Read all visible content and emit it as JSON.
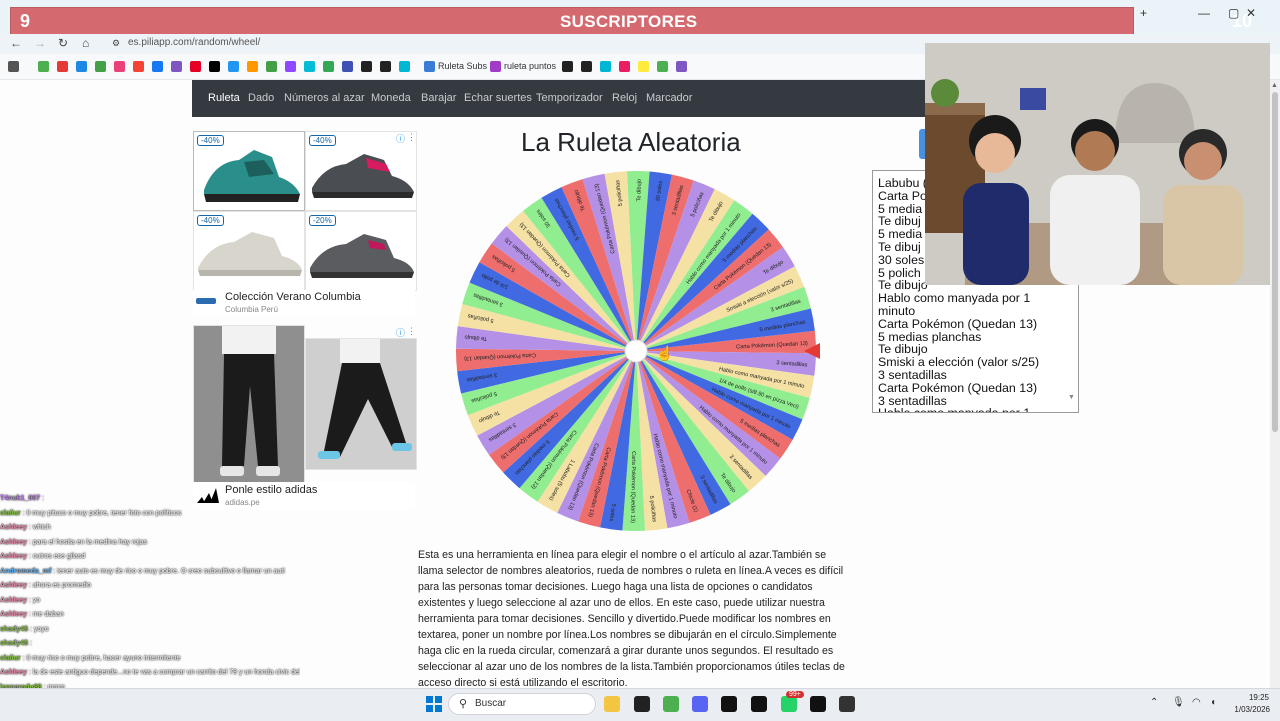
{
  "overlay": {
    "left_count": "9",
    "title": "SUSCRIPTORES",
    "right_count": "10",
    "window_controls": [
      "+",
      "—",
      "▢",
      "✕"
    ]
  },
  "browser": {
    "url": "es.piliapp.com/random/wheel/",
    "bookmarks": [
      {
        "label": "Ruleta Subs",
        "color": "#3a7bd5"
      },
      {
        "label": "ruleta puntos",
        "color": "#a03cc8"
      }
    ],
    "bookmark_icon_colors": [
      "#4caf50",
      "#e53935",
      "#1e88e5",
      "#43a047",
      "#ec407a",
      "#f44336",
      "#1877f2",
      "#7e57c2",
      "#e60023",
      "#000000",
      "#2196f3",
      "#ff9800",
      "#43a047",
      "#9146ff",
      "#00bcd4",
      "#34a853",
      "#3f51b5",
      "#222222",
      "#222222",
      "#00b8d4",
      "#e91e63",
      "#ffeb3b",
      "#4caf50",
      "#7e57c2"
    ]
  },
  "nav": {
    "items": [
      "Ruleta",
      "Dado",
      "Números al azar",
      "Moneda",
      "Barajar",
      "Echar suertes",
      "Temporizador",
      "Reloj",
      "Marcador"
    ],
    "active": "Ruleta"
  },
  "page": {
    "title": "La Ruleta Aleatoria"
  },
  "ads": {
    "shoe_discounts": [
      "-40%",
      "-40%",
      "-40%",
      "-20%"
    ],
    "columbia_title": "Colección Verano Columbia",
    "columbia_sub": "Columbia Perú",
    "adidas_title": "Ponle estilo adidas",
    "adidas_sub": "adidas.pe"
  },
  "wheel": {
    "segment_colors": [
      "#ee6e6e",
      "#b490e6",
      "#f5e1a4",
      "#90ee90",
      "#4169e1",
      "#ee6e6e",
      "#b490e6",
      "#f5e1a4",
      "#90ee90",
      "#4169e1"
    ],
    "labels": [
      "Carta Pokémon (Quedan 13)",
      "3 sentadillas",
      "Hablo como manyada por 1 minuto",
      "1/4 de pollo (s/8.90 en pizza Veci)",
      "Hablo como manyada por 1 minuto",
      "5 medias planchas",
      "Hablo como manyada por 1 minuto",
      "3 sentadillas",
      "Te dibujo",
      "3 sentadillas",
      "Chicle (1)",
      "Hablo como manyada por 1 minuto",
      "5 policiñas",
      "Carta Pokémon (Quedan 13)",
      "5 soles",
      "Carta Pokémon (Quedan 13)",
      "Carta Pokémon (Quedan 13)",
      "1 Labubu (5 soles)",
      "Carta Pokémon (Quedan 13)",
      "5 medias planchas",
      "Carta Pokémon (Quedan 13)",
      "3 sentadillas",
      "Te dibujo",
      "5 policiñas",
      "3 sentadillas",
      "Carta Pokémon (Quedan 13)",
      "Te dibujo",
      "5 policiñas",
      "3 sentadillas",
      "1/4 de pollo",
      "5 policiñas",
      "Carta Pokémon (Quedan 13)",
      "Carta Pokémon (Quedan 13)",
      "30 soles",
      "5 medias planchas",
      "Te dibujo",
      "Carta Pokémon (Quedan 13)",
      "5 policiñas",
      "Te dibujo",
      "30 soles",
      "3 sentadillas",
      "5 policiñas",
      "Te dibujo",
      "Hablo como manyada por 1 minuto",
      "5 medias planchas",
      "Carta Pokémon (Quedan 13)",
      "Te dibujo",
      "Smiski a elección (valor s/25)",
      "3 sentadillas",
      "5 medias planchas"
    ]
  },
  "names_list": [
    "Labubu (",
    "Carta Po",
    "5 media",
    "Te dibuj",
    "5 media",
    "Te dibuj",
    "30 soles",
    "5 polich",
    "Te dibujo",
    "Hablo como manyada por 1",
    "minuto",
    "Carta Pokémon (Quedan 13)",
    "5 medias planchas",
    "Te dibujo",
    "Smiski a elección (valor s/25)",
    "3 sentadillas",
    "Carta Pokémon (Quedan 13)",
    "3 sentadillas",
    "Hablo como manyada por 1"
  ],
  "description": "Esta es una herramienta en línea para elegir el nombre o el artículo al azar.También se llama selector de nombres aleatorios, rueda de nombres o ruleta en línea.A veces es difícil para las personas tomar decisiones. Luego haga una lista de opciones o candidatos existentes y luego seleccione al azar uno de ellos. En este caso, puede utilizar nuestra herramienta para tomar decisiones. Sencillo y divertido.Puede modificar los nombres en textarea, poner un nombre por línea.Los nombres se dibujarán en el círculo.Simplemente haga clic en la rueda circular, comenzará a girar durante unos segundos. El resultado es seleccionar al azar uno de los nombres de la lista.También proporcionamos útiles teclas de acceso directo si está utilizando el escritorio.",
  "chat": [
    {
      "user": "T4nuk1_007",
      "color": "#c77dff",
      "text": ":"
    },
    {
      "user": "claiiur",
      "color": "#8bc34a",
      "text": ": 0 muy pituco o muy pobre, tener foto con políticos"
    },
    {
      "user": "Ashleey",
      "color": "#f48fb1",
      "text": ": which"
    },
    {
      "user": "Ashleey",
      "color": "#f48fb1",
      "text": ": para el hostia en la medina hay rojas"
    },
    {
      "user": "Ashleey",
      "color": "#f48fb1",
      "text": ": cutros ese gilasd"
    },
    {
      "user": "Andromeda_mf",
      "color": "#64b5f6",
      "text": ": tener auto es muy de rico o muy pobre. O creo subcultivo o llamar un auti"
    },
    {
      "user": "Ashleey",
      "color": "#f48fb1",
      "text": ": ahora es promedio"
    },
    {
      "user": "Ashleey",
      "color": "#f48fb1",
      "text": ": yo"
    },
    {
      "user": "Ashleey",
      "color": "#f48fb1",
      "text": ": me daban"
    },
    {
      "user": "shady45",
      "color": "#8bc34a",
      "text": ": yoyo"
    },
    {
      "user": "shady45",
      "color": "#8bc34a",
      "text": ":"
    },
    {
      "user": "claiiur",
      "color": "#8bc34a",
      "text": ": 0 muy rico o muy pobre, hacer ayuno intermitente"
    },
    {
      "user": "Ashleey",
      "color": "#f48fb1",
      "text": ": la de este antiguo depende...no te vas a comprar un carrito del 78 y un honda civic del 2010"
    },
    {
      "user": "lennoradu88",
      "color": "#8bc34a",
      "text": ": mmm"
    }
  ],
  "taskbar": {
    "search_placeholder": "Buscar",
    "time": "19:25",
    "date": "1/03/2026",
    "badge": "99+"
  }
}
